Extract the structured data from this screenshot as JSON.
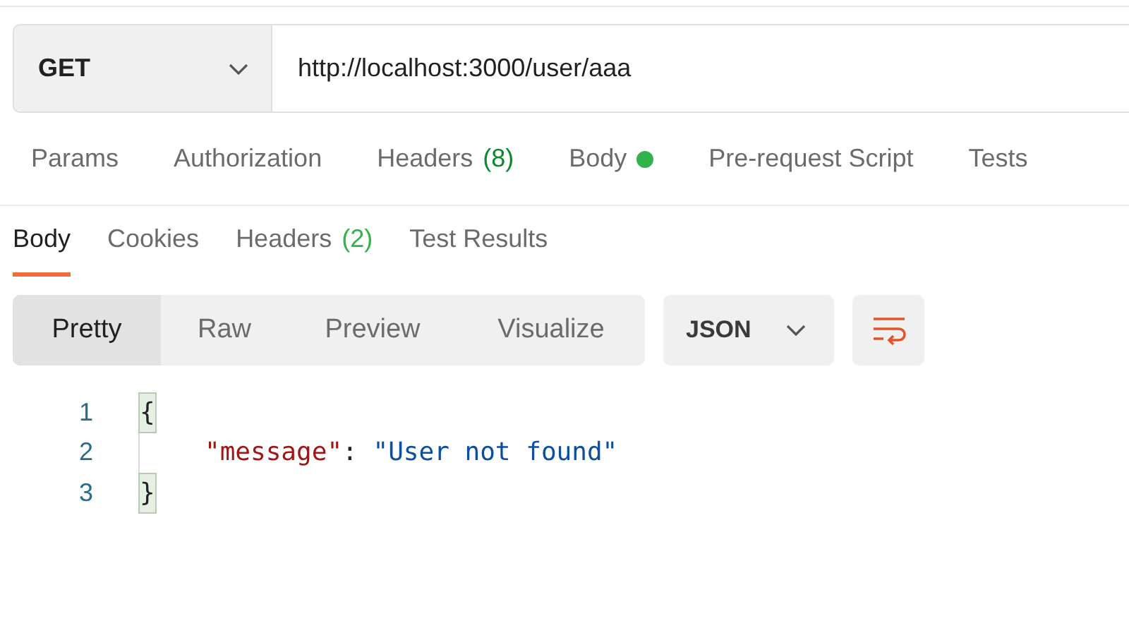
{
  "request": {
    "method": "GET",
    "url": "http://localhost:3000/user/aaa"
  },
  "request_tabs": [
    {
      "label": "Params",
      "selected": false
    },
    {
      "label": "Authorization",
      "selected": false
    },
    {
      "label": "Headers",
      "count": "(8)",
      "selected": false
    },
    {
      "label": "Body",
      "has_content": true,
      "selected": false
    },
    {
      "label": "Pre-request Script",
      "selected": false
    },
    {
      "label": "Tests",
      "selected": false
    }
  ],
  "response_tabs": [
    {
      "label": "Body",
      "selected": true
    },
    {
      "label": "Cookies",
      "selected": false
    },
    {
      "label": "Headers",
      "count": "(2)",
      "selected": false
    },
    {
      "label": "Test Results",
      "selected": false
    }
  ],
  "view_modes": [
    {
      "label": "Pretty",
      "selected": true
    },
    {
      "label": "Raw",
      "selected": false
    },
    {
      "label": "Preview",
      "selected": false
    },
    {
      "label": "Visualize",
      "selected": false
    }
  ],
  "format": "JSON",
  "code_lines": [
    {
      "number": "1",
      "indented": false,
      "tokens": [
        {
          "kind": "bracket",
          "text": "{"
        }
      ]
    },
    {
      "number": "2",
      "indented": true,
      "tokens": [
        {
          "kind": "key",
          "text": "\"message\""
        },
        {
          "kind": "punct",
          "text": ": "
        },
        {
          "kind": "string",
          "text": "\"User not found\""
        }
      ]
    },
    {
      "number": "3",
      "indented": false,
      "tokens": [
        {
          "kind": "bracket",
          "text": "}"
        }
      ]
    }
  ]
}
